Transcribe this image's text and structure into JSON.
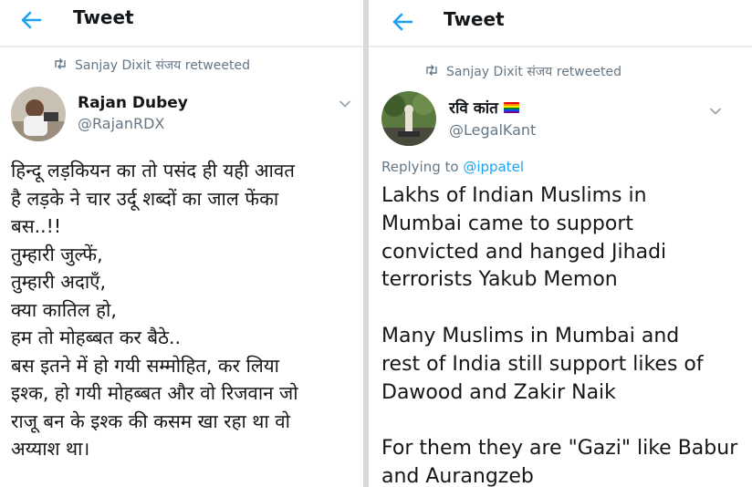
{
  "colors": {
    "accent": "#1da1f2",
    "secondary_text": "#657786",
    "text": "#14171a",
    "divider": "#d8d8d8"
  },
  "left": {
    "header": {
      "title": "Tweet",
      "back_icon": "arrow-left-icon"
    },
    "retweet": {
      "text": "Sanjay Dixit संजय retweeted",
      "icon": "retweet-icon"
    },
    "user": {
      "name": "Rajan Dubey",
      "handle": "@RajanRDX"
    },
    "body": "हिन्दू लड़कियन का तो पसंद ही यही आवत\nहै लड़के ने चार उर्दू शब्दों का जाल फेंका\nबस..!!\nतुम्हारी जुल्फें,\nतुम्हारी अदाएँ,\nक्या कातिल हो,\nहम तो मोहब्बत कर बैठे..\nबस इतने में हो गयी सम्मोहित, कर लिया\nइश्क, हो गयी मोहब्बत और वो रिजवान जो\nराजू बन के इश्क की कसम खा रहा था वो\nअय्याश था।"
  },
  "right": {
    "header": {
      "title": "Tweet",
      "back_icon": "arrow-left-icon"
    },
    "retweet": {
      "text": "Sanjay Dixit संजय retweeted",
      "icon": "retweet-icon"
    },
    "user": {
      "name": "रवि कांत",
      "handle": "@LegalKant",
      "flag_icon": "rainbow-flag-icon"
    },
    "replying": {
      "prefix": "Replying to ",
      "mention": "@ippatel"
    },
    "body": "Lakhs of Indian Muslims in\nMumbai came to support\nconvicted and hanged Jihadi\nterrorists Yakub Memon\n\nMany Muslims in Mumbai and\nrest of India still support likes of\nDawood and Zakir Naik\n\nFor them they are \"Gazi\" like Babur\nand Aurangzeb"
  }
}
